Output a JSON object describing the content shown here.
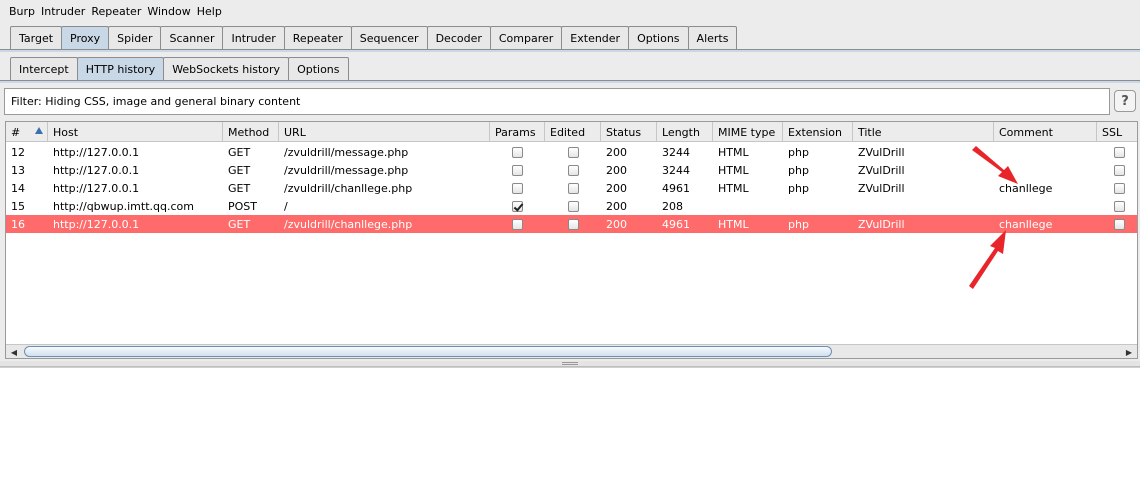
{
  "menu": [
    "Burp",
    "Intruder",
    "Repeater",
    "Window",
    "Help"
  ],
  "main_tabs": [
    {
      "label": "Target",
      "active": false
    },
    {
      "label": "Proxy",
      "active": true
    },
    {
      "label": "Spider",
      "active": false
    },
    {
      "label": "Scanner",
      "active": false
    },
    {
      "label": "Intruder",
      "active": false
    },
    {
      "label": "Repeater",
      "active": false
    },
    {
      "label": "Sequencer",
      "active": false
    },
    {
      "label": "Decoder",
      "active": false
    },
    {
      "label": "Comparer",
      "active": false
    },
    {
      "label": "Extender",
      "active": false
    },
    {
      "label": "Options",
      "active": false
    },
    {
      "label": "Alerts",
      "active": false
    }
  ],
  "proxy_tabs": [
    {
      "label": "Intercept",
      "active": false
    },
    {
      "label": "HTTP history",
      "active": true
    },
    {
      "label": "WebSockets history",
      "active": false
    },
    {
      "label": "Options",
      "active": false
    }
  ],
  "filter": {
    "text": "Filter:  Hiding CSS, image and general binary content",
    "help": "?"
  },
  "table": {
    "columns": [
      "#",
      "Host",
      "Method",
      "URL",
      "Params",
      "Edited",
      "Status",
      "Length",
      "MIME type",
      "Extension",
      "Title",
      "Comment",
      "SSL"
    ],
    "rows": [
      {
        "num": "12",
        "host": "http://127.0.0.1",
        "method": "GET",
        "url": "/zvuldrill/message.php",
        "params": false,
        "edited": false,
        "status": "200",
        "length": "3244",
        "mime": "HTML",
        "ext": "php",
        "title": "ZVulDrill",
        "comment": "",
        "ssl": false,
        "selected": false
      },
      {
        "num": "13",
        "host": "http://127.0.0.1",
        "method": "GET",
        "url": "/zvuldrill/message.php",
        "params": false,
        "edited": false,
        "status": "200",
        "length": "3244",
        "mime": "HTML",
        "ext": "php",
        "title": "ZVulDrill",
        "comment": "",
        "ssl": false,
        "selected": false
      },
      {
        "num": "14",
        "host": "http://127.0.0.1",
        "method": "GET",
        "url": "/zvuldrill/chanllege.php",
        "params": false,
        "edited": false,
        "status": "200",
        "length": "4961",
        "mime": "HTML",
        "ext": "php",
        "title": "ZVulDrill",
        "comment": "chanllege",
        "ssl": false,
        "selected": false
      },
      {
        "num": "15",
        "host": "http://qbwup.imtt.qq.com",
        "method": "POST",
        "url": "/",
        "params": true,
        "edited": false,
        "status": "200",
        "length": "208",
        "mime": "",
        "ext": "",
        "title": "",
        "comment": "",
        "ssl": false,
        "selected": false
      },
      {
        "num": "16",
        "host": "http://127.0.0.1",
        "method": "GET",
        "url": "/zvuldrill/chanllege.php",
        "params": false,
        "edited": false,
        "status": "200",
        "length": "4961",
        "mime": "HTML",
        "ext": "php",
        "title": "ZVulDrill",
        "comment": "chanllege",
        "ssl": false,
        "selected": true
      }
    ]
  },
  "colors": {
    "selected_row": "#ff6b6b",
    "active_tab": "#c9d8e6",
    "annotation_arrow": "#e8252b"
  },
  "icons": {
    "scroll_left": "◀",
    "scroll_right": "▶",
    "sort_ascending": "sort-ascending-icon"
  }
}
